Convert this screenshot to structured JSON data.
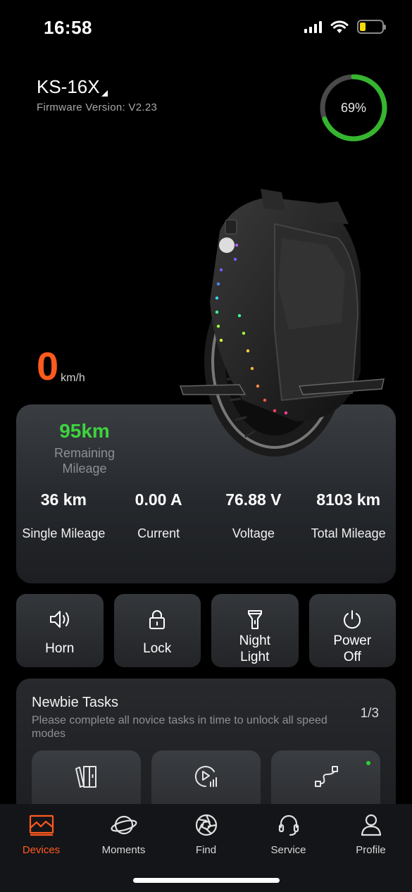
{
  "status_bar": {
    "time": "16:58"
  },
  "device": {
    "name": "KS-16X",
    "firmware": "Firmware Version: V2.23",
    "battery_percent": 69,
    "battery_label": "69%"
  },
  "speed": {
    "value": "0",
    "unit": "km/h"
  },
  "remaining": {
    "value": "95km",
    "label": "Remaining Mileage"
  },
  "stats": [
    {
      "value": "36 km",
      "label": "Single Mileage"
    },
    {
      "value": "0.00 A",
      "label": "Current"
    },
    {
      "value": "76.88 V",
      "label": "Voltage"
    },
    {
      "value": "8103 km",
      "label": "Total Mileage"
    }
  ],
  "actions": [
    {
      "label": "Horn",
      "icon": "speaker-icon"
    },
    {
      "label": "Lock",
      "icon": "lock-icon"
    },
    {
      "label_line1": "Night",
      "label_line2": "Light",
      "icon": "flashlight-icon"
    },
    {
      "label_line1": "Power",
      "label_line2": "Off",
      "icon": "power-icon"
    }
  ],
  "tasks": {
    "title": "Newbie Tasks",
    "description": "Please complete all novice tasks in time to unlock all speed modes",
    "progress": "1/3",
    "tiles": [
      {
        "icon": "books-icon"
      },
      {
        "icon": "video-play-icon"
      },
      {
        "icon": "route-icon",
        "new_dot": true
      }
    ]
  },
  "tabs": [
    {
      "label": "Devices",
      "icon": "devices-icon",
      "active": true
    },
    {
      "label": "Moments",
      "icon": "planet-icon",
      "active": false
    },
    {
      "label": "Find",
      "icon": "aperture-icon",
      "active": false
    },
    {
      "label": "Service",
      "icon": "headset-icon",
      "active": false
    },
    {
      "label": "Profile",
      "icon": "person-icon",
      "active": false
    }
  ],
  "colors": {
    "accent_orange": "#ff5a1e",
    "battery_green": "#35b62e",
    "remaining_green": "#3ed33e",
    "status_battery_yellow": "#f5d90a"
  }
}
